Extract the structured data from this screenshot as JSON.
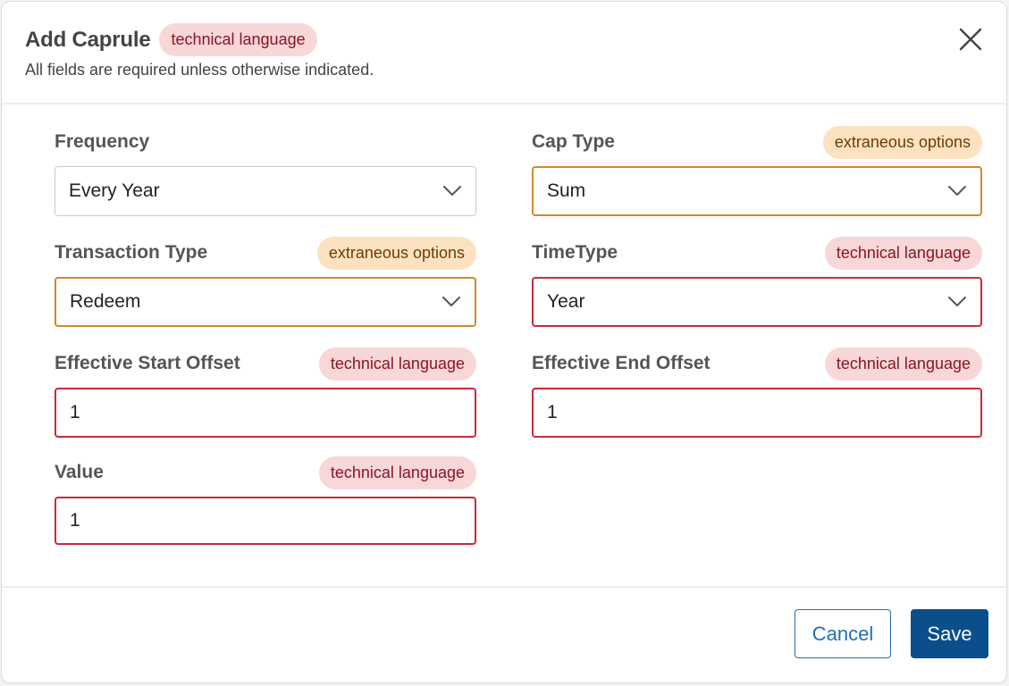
{
  "header": {
    "title": "Add Caprule",
    "title_badge": "technical language",
    "subtitle": "All fields are required unless otherwise indicated."
  },
  "fields": {
    "frequency": {
      "label": "Frequency",
      "value": "Every Year"
    },
    "cap_type": {
      "label": "Cap Type",
      "badge": "extraneous options",
      "value": "Sum"
    },
    "transaction_type": {
      "label": "Transaction Type",
      "badge": "extraneous options",
      "value": "Redeem"
    },
    "time_type": {
      "label": "TimeType",
      "badge": "technical language",
      "value": "Year"
    },
    "effective_start_offset": {
      "label": "Effective Start Offset",
      "badge": "technical language",
      "value": "1"
    },
    "effective_end_offset": {
      "label": "Effective End Offset",
      "badge": "technical language",
      "value": "1"
    },
    "value": {
      "label": "Value",
      "badge": "technical language",
      "value": "1"
    }
  },
  "footer": {
    "cancel_label": "Cancel",
    "save_label": "Save"
  },
  "colors": {
    "primary": "#0b4e8c",
    "link": "#1f6fb5",
    "error_border": "#c82b3a",
    "warning_border": "#d08a2a",
    "tech_badge_bg": "#f8d7d8",
    "extra_badge_bg": "#fde2c2"
  },
  "icons": {
    "close": "close-icon",
    "dropdown": "chevron-down-icon"
  }
}
